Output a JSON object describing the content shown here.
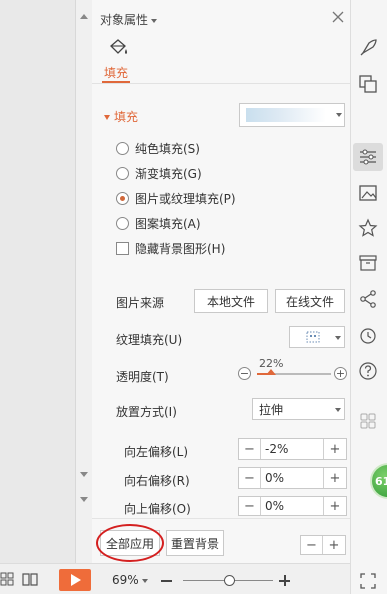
{
  "pane": {
    "title": "对象属性",
    "tab_label": "填充",
    "section_fill": "填充",
    "fill_options": [
      {
        "label": "纯色填充(S)",
        "type": "radio",
        "checked": false
      },
      {
        "label": "渐变填充(G)",
        "type": "radio",
        "checked": false
      },
      {
        "label": "图片或纹理填充(P)",
        "type": "radio",
        "checked": true
      },
      {
        "label": "图案填充(A)",
        "type": "radio",
        "checked": false
      },
      {
        "label": "隐藏背景图形(H)",
        "type": "checkbox",
        "checked": false
      }
    ],
    "image_source": {
      "label": "图片来源",
      "local_button": "本地文件",
      "online_button": "在线文件"
    },
    "texture_fill": {
      "label": "纹理填充(U)"
    },
    "transparency": {
      "label": "透明度(T)",
      "value": "22%",
      "fraction": 0.22
    },
    "placement": {
      "label": "放置方式(I)",
      "value": "拉伸"
    },
    "offset_left": {
      "label": "向左偏移(L)",
      "value": "-2%"
    },
    "offset_right": {
      "label": "向右偏移(R)",
      "value": "0%"
    },
    "offset_up": {
      "label": "向上偏移(O)",
      "value": "0%"
    },
    "apply_all_button": "全部应用",
    "reset_bg_button": "重置背景"
  },
  "right_toolbar": {
    "icons": [
      "rocket-icon",
      "shapes-icon",
      "properties-icon",
      "image-icon",
      "star-icon",
      "archive-icon",
      "share-icon",
      "history-icon",
      "help-icon",
      "grid-icon"
    ],
    "bubble_text": "61"
  },
  "status_bar": {
    "zoom": "69%"
  },
  "colors": {
    "accent": "#e0683a",
    "highlight": "#d42020",
    "play": "#ef6c3a"
  }
}
